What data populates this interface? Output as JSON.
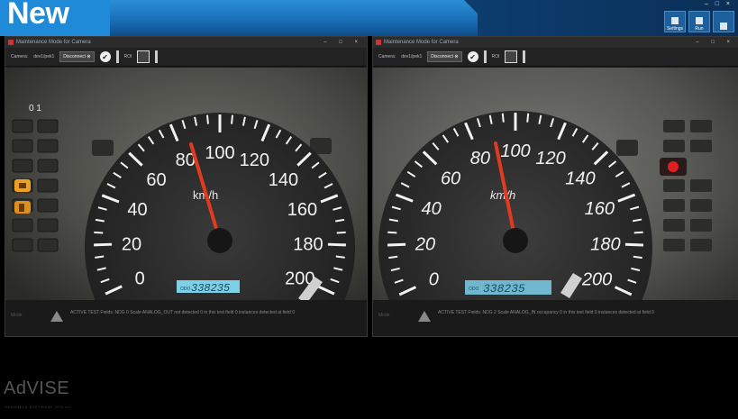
{
  "badge": {
    "text": "New"
  },
  "topbar": {
    "buttons": [
      {
        "label": "Settings"
      },
      {
        "label": "Run"
      },
      {
        "label": ""
      }
    ],
    "window_controls": "– □ ×"
  },
  "windows": [
    {
      "title": "Maintenance Mode for Camera",
      "window_controls": "– □ ×",
      "toolbar": {
        "camera_label": "Camera:",
        "camera_value": "dev1/pek1",
        "disconnect_label": "Disconnect",
        "roi_label": "ROI"
      },
      "display": {
        "trip": "0 1",
        "odometer_label": "ODO",
        "odometer": "338235",
        "speed_labels": [
          "0",
          "20",
          "40",
          "60",
          "80",
          "100",
          "120",
          "140",
          "160",
          "180",
          "200"
        ],
        "unit": "km/h",
        "lamps": [
          "engine-lamp",
          "fuel-lamp"
        ]
      },
      "status": {
        "label": "Mode",
        "message": "ACTIVE  TEST  Fields:  NDG 0  Scale  ANALOG_OUT  not detected  0  in this test field  0  instances  detected at field  0"
      }
    },
    {
      "title": "Maintenance Mode for Camera",
      "window_controls": "– □ ×",
      "toolbar": {
        "camera_label": "Camera:",
        "camera_value": "dev1/pek1",
        "disconnect_label": "Disconnect",
        "roi_label": "ROI"
      },
      "display": {
        "odometer_label": "ODO",
        "odometer": "338235",
        "speed_labels": [
          "0",
          "20",
          "40",
          "60",
          "80",
          "100",
          "120",
          "140",
          "160",
          "180",
          "200"
        ],
        "unit": "km/h",
        "lamps": [
          "airbag-lamp"
        ]
      },
      "status": {
        "label": "Mode",
        "message": "ACTIVE  TEST  Fields:  NDG 2  Scale  ANALOG_IN  occupancy  0  in this test field  0  instances  detected at field  0"
      }
    }
  ],
  "footer": {
    "logo": "AdVISE",
    "subtitle": "HANDHELD SOFTWARE USA Inc."
  },
  "colors": {
    "topbar": "#1a6fb8",
    "badge": "#1e8ad8",
    "needle": "#e03a20",
    "odometer": "#7cd0e8",
    "amber": "#f0a020",
    "red_lamp": "#e02020"
  }
}
